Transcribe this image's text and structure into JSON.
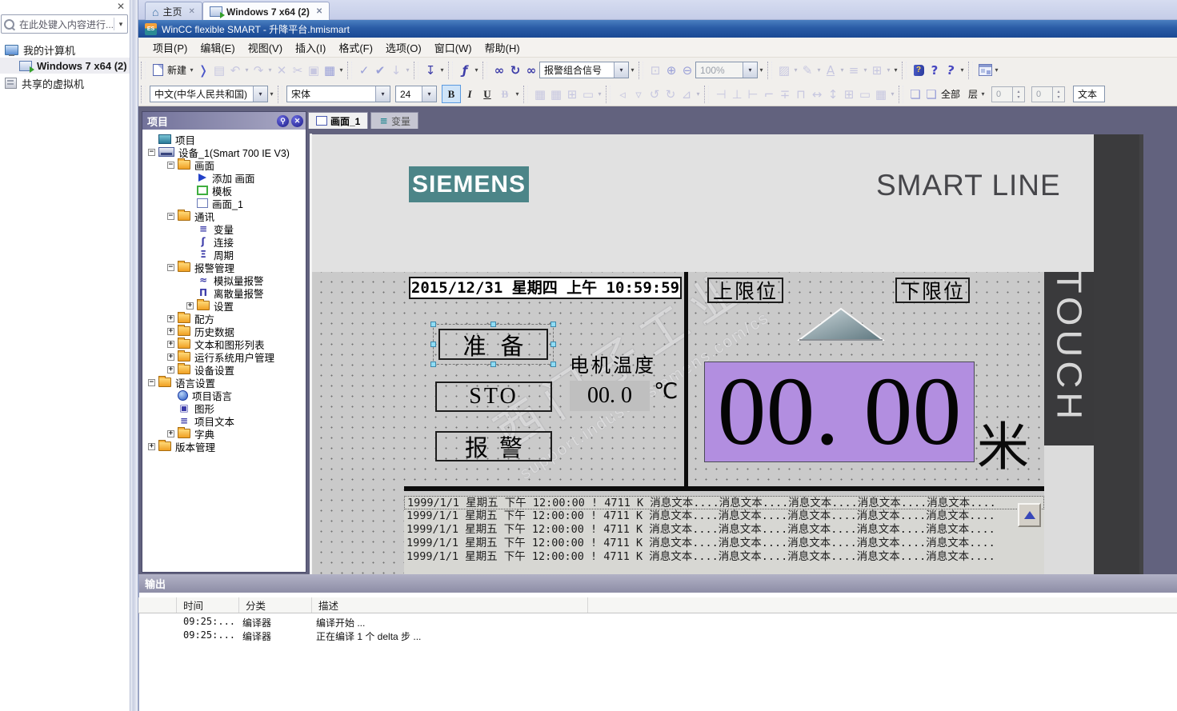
{
  "icons": {
    "caret": "▾",
    "close": "✕",
    "home": "⌂",
    "minus": "−",
    "plus": "+",
    "save": "▤",
    "undo": "↶",
    "redo": "↷",
    "delete": "✕",
    "cut": "✂",
    "copy": "▣",
    "paste": "▦",
    "check": "✓",
    "gen": "✔",
    "transfer": "↓",
    "compile": "↧",
    "fn": "ƒ",
    "find": "∞",
    "sync": "↻",
    "findnext": "∞",
    "zoomsel": "⊡",
    "zoomin": "⊕",
    "zoomout": "⊖",
    "fill": "▨",
    "brush": "✎",
    "fontcolor": "A",
    "linestyle": "≡",
    "border": "⊞",
    "helpindex": "?",
    "helpsearch": "?",
    "flip1": "◃",
    "flip2": "▿",
    "rot1": "↺",
    "rot2": "↻",
    "rot3": "⊿",
    "al1": "⊣",
    "al2": "⊥",
    "al3": "⊢",
    "al4": "⌐",
    "al5": "∓",
    "al6": "⊓",
    "al7": "▭",
    "al8": "↔",
    "al9": "↕",
    "al10": "⊞",
    "al11": "▦",
    "layer1": "❏",
    "layer2": "❏",
    "spin-up": "▴",
    "spin-dn": "▾",
    "tag": "≡",
    "conn": "ʃ",
    "cycle": "Ξ",
    "analog": "≈",
    "discrete": "Π",
    "graphics": "▣",
    "text": "≡",
    "vartab": "≡"
  },
  "vmware": {
    "sidebar": {
      "search_placeholder": "在此处键入内容进行...",
      "my_computer": "我的计算机",
      "vm_name": "Windows 7 x64 (2)",
      "shared_vms": "共享的虚拟机"
    },
    "tabs": {
      "home": "主页",
      "vm": "Windows 7 x64 (2)"
    }
  },
  "wincc": {
    "title": "WinCC flexible SMART - 升降平台.hmismart",
    "menus": [
      "项目(P)",
      "编辑(E)",
      "视图(V)",
      "插入(I)",
      "格式(F)",
      "选项(O)",
      "窗口(W)",
      "帮助(H)"
    ],
    "toolbar": {
      "new_label": "新建",
      "alarm_combo": "报警组合信号",
      "zoom_value": "100%",
      "language_combo": "中文(中华人民共和国)",
      "font_name": "宋体",
      "font_size": "24",
      "bold": "B",
      "italic": "I",
      "underline": "U",
      "strike": "B",
      "all_label": "全部",
      "layer_label": "层",
      "spin1": "0",
      "spin2": "0",
      "text_cut": "文本"
    },
    "project_panel": {
      "title": "项目",
      "tree": [
        {
          "label": "项目"
        },
        {
          "label": "设备_1(Smart 700 IE V3)"
        },
        {
          "label": "画面"
        },
        {
          "label": "添加 画面"
        },
        {
          "label": "模板"
        },
        {
          "label": "画面_1"
        },
        {
          "label": "通讯"
        },
        {
          "label": "变量"
        },
        {
          "label": "连接"
        },
        {
          "label": "周期"
        },
        {
          "label": "报警管理"
        },
        {
          "label": "模拟量报警"
        },
        {
          "label": "离散量报警"
        },
        {
          "label": "设置"
        },
        {
          "label": "配方"
        },
        {
          "label": "历史数据"
        },
        {
          "label": "文本和图形列表"
        },
        {
          "label": "运行系统用户管理"
        },
        {
          "label": "设备设置"
        },
        {
          "label": "语言设置"
        },
        {
          "label": "项目语言"
        },
        {
          "label": "图形"
        },
        {
          "label": "项目文本"
        },
        {
          "label": "字典"
        },
        {
          "label": "版本管理"
        }
      ]
    },
    "editor_tabs": {
      "screen": "画面_1",
      "tags": "变量"
    },
    "screen": {
      "brand": "SIEMENS",
      "line": "SMART LINE",
      "touch": "TOUCH",
      "datetime": "2015/12/31 星期四 上午 10:59:59",
      "btn_ready": "准备",
      "btn_sto": "STO",
      "btn_alarm": "报警",
      "temp_label": "电机温度",
      "temp_value": "00. 0",
      "temp_unit": "℃",
      "upper_limit": "上限位",
      "lower_limit": "下限位",
      "meter_value": "00. 00",
      "meter_unit": "米",
      "alarm_row": "1999/1/1 星期五 下午 12:00:00 ! 4711 K 消息文本....消息文本....消息文本....消息文本....消息文本....",
      "watermark_cn": "西门子工业",
      "watermark_url": "support.industry.siemens.com/cs"
    },
    "output_panel": {
      "title": "输出",
      "columns": [
        "时间",
        "分类",
        "描述"
      ],
      "rows": [
        [
          "09:25:...",
          "编译器",
          "编译开始 ..."
        ],
        [
          "09:25:...",
          "编译器",
          "正在编译 1 个 delta 步 ..."
        ]
      ]
    }
  }
}
